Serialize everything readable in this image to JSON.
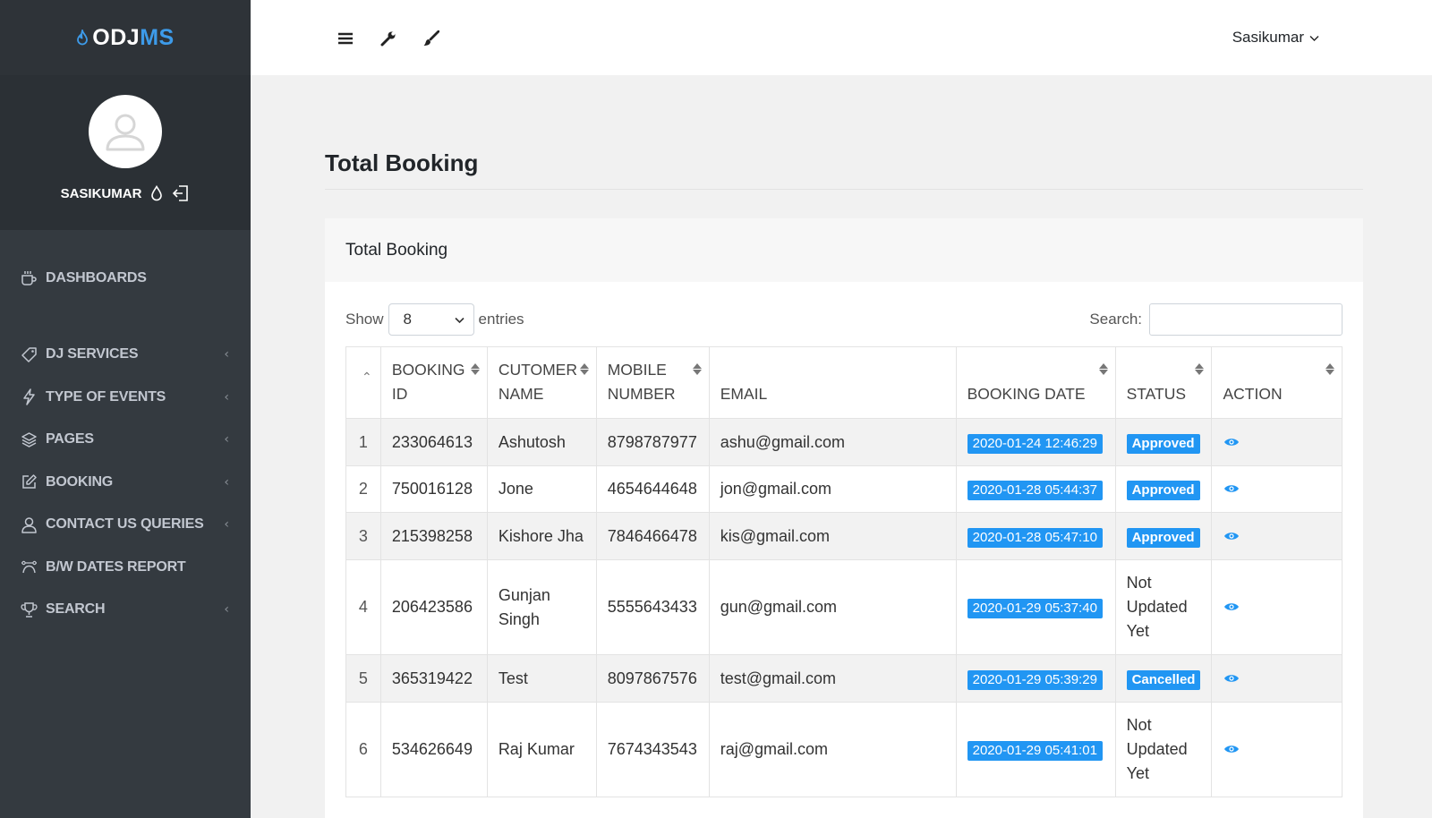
{
  "brand": {
    "prefix": "ODJ",
    "accent": "MS",
    "accent_color": "#3d9be9",
    "icon": "flame-icon"
  },
  "user_panel": {
    "name": "SASIKUMAR"
  },
  "sidebar": {
    "items": [
      {
        "label": "DASHBOARDS",
        "icon": "coffee-cup-icon",
        "has_caret": false
      },
      {
        "label": "DJ SERVICES",
        "icon": "tag-icon",
        "has_caret": true
      },
      {
        "label": "TYPE OF EVENTS",
        "icon": "bolt-icon",
        "has_caret": true
      },
      {
        "label": "PAGES",
        "icon": "layers-icon",
        "has_caret": true
      },
      {
        "label": "BOOKING",
        "icon": "edit-icon",
        "has_caret": true
      },
      {
        "label": "CONTACT US QUERIES",
        "icon": "user-icon",
        "has_caret": true
      },
      {
        "label": "B/W DATES REPORT",
        "icon": "curve-icon",
        "has_caret": false
      },
      {
        "label": "SEARCH",
        "icon": "trophy-icon",
        "has_caret": true
      }
    ]
  },
  "header": {
    "user_name": "Sasikumar"
  },
  "page": {
    "title": "Total Booking"
  },
  "card": {
    "title": "Total Booking",
    "show_label": "Show",
    "entries_label": "entries",
    "page_length": "8",
    "search_label": "Search:",
    "search_value": ""
  },
  "table": {
    "headers": {
      "booking_id": [
        "BOOKING",
        "ID"
      ],
      "customer_name": [
        "CUTOMER",
        "NAME"
      ],
      "mobile": [
        "MOBILE",
        "NUMBER"
      ],
      "email": "EMAIL",
      "booking_date": "BOOKING DATE",
      "status": "STATUS",
      "action": "ACTION"
    },
    "rows": [
      {
        "n": "1",
        "id": "233064613",
        "name": "Ashutosh",
        "mobile": "8798787977",
        "email": "ashu@gmail.com",
        "date": "2020-01-24 12:46:29",
        "status": "Approved"
      },
      {
        "n": "2",
        "id": "750016128",
        "name": "Jone",
        "mobile": "4654644648",
        "email": "jon@gmail.com",
        "date": "2020-01-28 05:44:37",
        "status": "Approved"
      },
      {
        "n": "3",
        "id": "215398258",
        "name": "Kishore Jha",
        "mobile": "7846466478",
        "email": "kis@gmail.com",
        "date": "2020-01-28 05:47:10",
        "status": "Approved"
      },
      {
        "n": "4",
        "id": "206423586",
        "name": "Gunjan Singh",
        "mobile": "5555643433",
        "email": "gun@gmail.com",
        "date": "2020-01-29 05:37:40",
        "status": "Not Updated Yet"
      },
      {
        "n": "5",
        "id": "365319422",
        "name": "Test",
        "mobile": "8097867576",
        "email": "test@gmail.com",
        "date": "2020-01-29 05:39:29",
        "status": "Cancelled"
      },
      {
        "n": "6",
        "id": "534626649",
        "name": "Raj Kumar",
        "mobile": "7674343543",
        "email": "raj@gmail.com",
        "date": "2020-01-29 05:41:01",
        "status": "Not Updated Yet"
      }
    ]
  },
  "colors": {
    "approved": "#2196f3",
    "cancelled": "#2196f3",
    "eye": "#2196f3"
  }
}
